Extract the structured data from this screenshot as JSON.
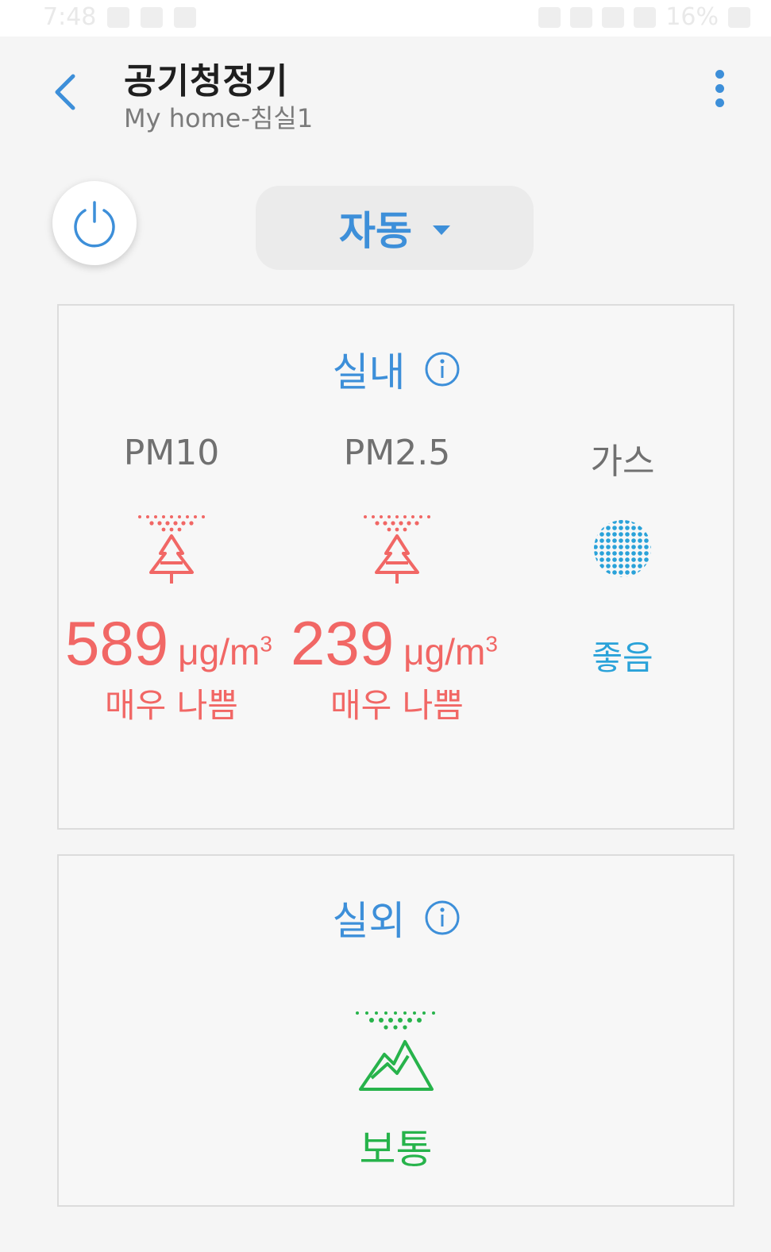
{
  "status_bar": {
    "time": "7:48",
    "battery": "16%"
  },
  "header": {
    "title": "공기청정기",
    "subtitle": "My home-침실1"
  },
  "controls": {
    "mode_label": "자동"
  },
  "indoor": {
    "title": "실내",
    "metrics": [
      {
        "label": "PM10",
        "value": "589",
        "unit": "μg/m",
        "unit_sup": "3",
        "status": "매우 나쁨"
      },
      {
        "label": "PM2.5",
        "value": "239",
        "unit": "μg/m",
        "unit_sup": "3",
        "status": "매우 나쁨"
      },
      {
        "label": "가스",
        "status": "좋음"
      }
    ]
  },
  "outdoor": {
    "title": "실외",
    "status": "보통"
  },
  "colors": {
    "accent": "#3d8fd9",
    "bad": "#f16765",
    "good": "#2aa2d9",
    "normal": "#27b34b"
  },
  "icons": [
    "back-icon",
    "more-icon",
    "power-icon",
    "dropdown-caret-icon",
    "info-icon",
    "tree-dust-icon",
    "gas-dots-icon",
    "mountain-dust-icon"
  ]
}
